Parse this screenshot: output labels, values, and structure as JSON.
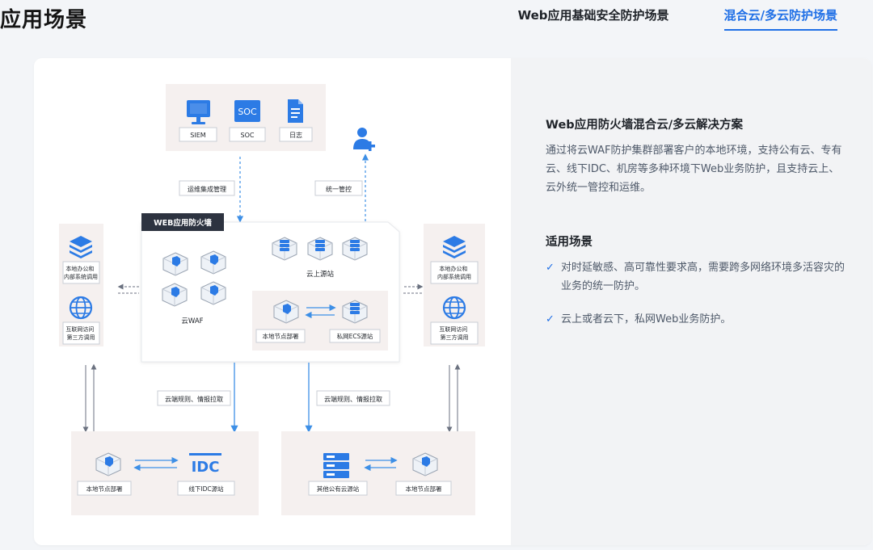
{
  "page": {
    "title": "应用场景",
    "tabs": [
      {
        "label": "Web应用基础安全防护场景",
        "active": false
      },
      {
        "label": "混合云/多云防护场景",
        "active": true
      }
    ]
  },
  "colors": {
    "accent": "#1f6fe6",
    "arrow_blue": "#3d8fe6",
    "box_bg": "#f5f0ef",
    "label_border": "#c9ced6"
  },
  "diagram": {
    "top_panel": {
      "items": [
        {
          "icon": "monitor-icon",
          "label": "SIEM"
        },
        {
          "icon": "soc-icon",
          "label": "SOC",
          "icon_text": "SOC"
        },
        {
          "icon": "document-icon",
          "label": "日志"
        }
      ]
    },
    "admin_icon": "add-user-icon",
    "link_labels": {
      "ops": "运维集成管理",
      "control": "统一管控",
      "rules_left": "云端规则、情报拉取",
      "rules_right": "云端规则、情报拉取"
    },
    "waf_panel": {
      "tag": "WEB应用防火墙",
      "cloud_waf_label": "云WAF",
      "cloud_origin_label": "云上源站",
      "local_node_label": "本地节点部署",
      "private_ecs_label": "私网ECS源站"
    },
    "left_panel": {
      "office": "本地办公和\n内部系统调用",
      "internet": "互联网访问\n第三方调用"
    },
    "right_panel": {
      "office": "本地办公和\n内部系统调用",
      "internet": "互联网访问\n第三方调用"
    },
    "bottom_left": {
      "node_label": "本地节点部署",
      "idc_label": "线下IDC源站",
      "idc_text": "IDC"
    },
    "bottom_right": {
      "other_cloud_label": "其他公有云源站",
      "node_label": "本地节点部署"
    }
  },
  "solution": {
    "title": "Web应用防火墙混合云/多云解决方案",
    "description": "通过将云WAF防护集群部署客户的本地环境，支持公有云、专有云、线下IDC、机房等多种环境下Web业务防护，且支持云上、云外统一管控和运维。"
  },
  "scenarios": {
    "title": "适用场景",
    "check_icon": "checkmark-icon",
    "items": [
      "对时延敏感、高可靠性要求高，需要跨多网络环境多活容灾的业务的统一防护。",
      "云上或者云下，私网Web业务防护。"
    ]
  }
}
